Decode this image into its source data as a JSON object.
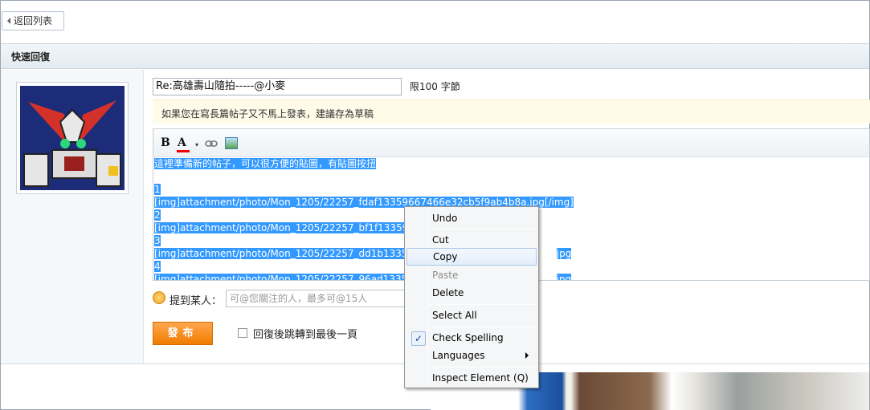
{
  "nav": {
    "back_label": "返回列表"
  },
  "quick_reply": {
    "title": "快速回復"
  },
  "form": {
    "subject_value": "Re:高雄壽山隨拍-----@小麥",
    "limit_label": "限100 字節",
    "draft_notice": "如果您在寫長篇帖子又不馬上發表，建議存為草稿",
    "mention_label": "提到某人：",
    "mention_placeholder": "可@您關注的人，最多可@15人",
    "publish_label": "發布",
    "jump_label": "回復後跳轉到最後一頁"
  },
  "toolbar": {
    "bold": "B",
    "font_color": "A",
    "drop": "▾"
  },
  "editor": {
    "lines": [
      "這裡準備新的帖子，可以很方便的貼圖，有貼圖按扭",
      "",
      "1",
      "[img]attachment/photo/Mon_1205/22257_fdaf13359667466e32cb5f9ab4b8a.jpg[/img]",
      "2",
      "[img]attachment/photo/Mon_1205/22257_bf1f1335966",
      "3",
      "[img]attachment/photo/Mon_1205/22257_dd1b133596",
      "4",
      "[img]attachment/photo/Mon_1205/22257_96ad133596"
    ],
    "line_tails": [
      "",
      "",
      "",
      "",
      "",
      "",
      "",
      "jpg",
      "",
      "jpg"
    ]
  },
  "context_menu": {
    "undo": "Undo",
    "cut": "Cut",
    "copy": "Copy",
    "paste": "Paste",
    "delete": "Delete",
    "select_all": "Select All",
    "check_spelling": "Check Spelling",
    "check_mark": "✓",
    "languages": "Languages",
    "inspect": "Inspect Element (Q)"
  },
  "colors": {
    "selection": "#3399ff",
    "publish": "#f07d00",
    "header_bg": "#e3ebf1"
  }
}
